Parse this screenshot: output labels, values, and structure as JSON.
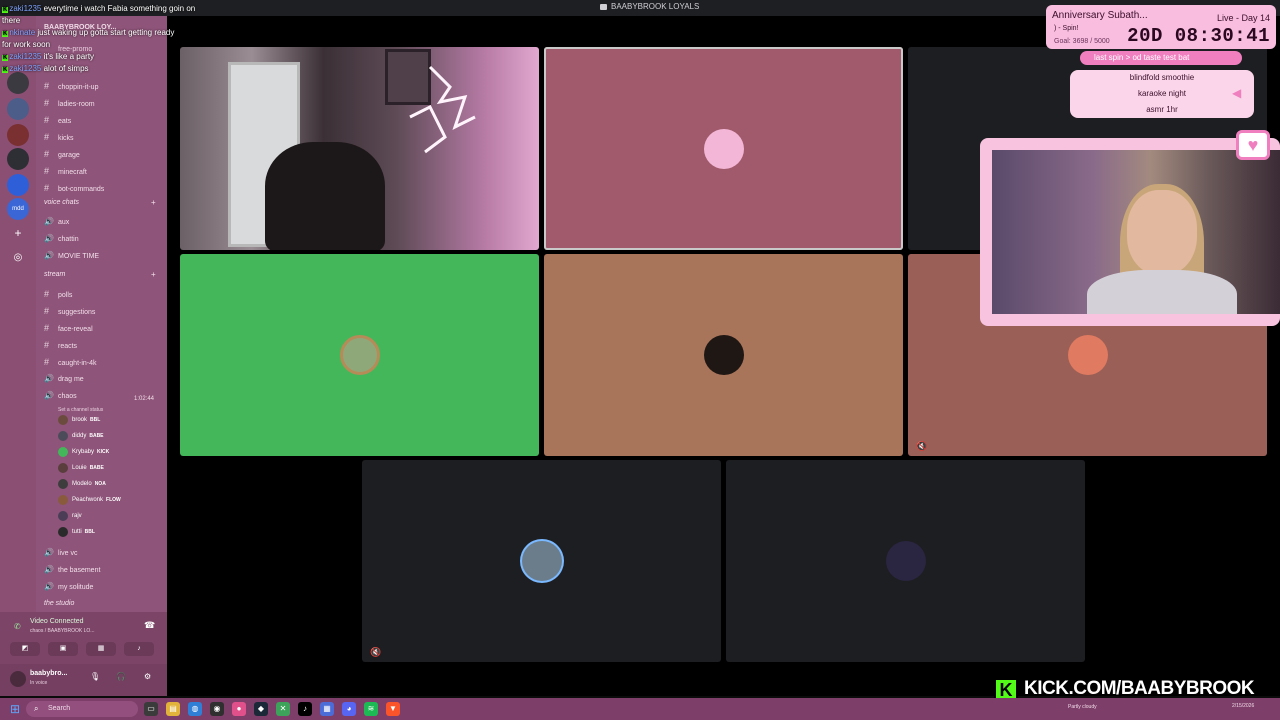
{
  "window": {
    "title": "BAABYBROOK LOYALS"
  },
  "server": {
    "name": "BAABYBROOK LOY...",
    "promo": "free-promo"
  },
  "chat": [
    {
      "user": "zaki1235",
      "text": "everytime i watch Fabia something goin on"
    },
    {
      "user": "",
      "text": "there"
    },
    {
      "user": "nkinate",
      "text": "just waking up gotta start getting ready"
    },
    {
      "user": "",
      "text": "for work soon"
    },
    {
      "user": "zaki1235",
      "text": "it's like a party"
    },
    {
      "user": "zaki1235",
      "text": "alot of simps"
    }
  ],
  "channels": {
    "text_top": [
      {
        "icon": "#",
        "label": "choppin-it-up"
      },
      {
        "icon": "#",
        "label": "ladies-room"
      },
      {
        "icon": "#",
        "label": "eats"
      },
      {
        "icon": "#",
        "label": "kicks"
      },
      {
        "icon": "#",
        "label": "garage"
      },
      {
        "icon": "#",
        "label": "minecraft"
      },
      {
        "icon": "#",
        "label": "bot-commands"
      }
    ],
    "voice_category": "voice chats",
    "voice_top": [
      {
        "icon": "🔊",
        "label": "aux"
      },
      {
        "icon": "🔊",
        "label": "chattin"
      },
      {
        "icon": "🔊",
        "label": "MOVIE TIME"
      }
    ],
    "stream_category": "stream",
    "stream_channels": [
      {
        "icon": "#",
        "label": "polls"
      },
      {
        "icon": "#",
        "label": "suggestions"
      },
      {
        "icon": "#",
        "label": "face-reveal"
      },
      {
        "icon": "#",
        "label": "reacts"
      },
      {
        "icon": "#",
        "label": "caught-in-4k"
      },
      {
        "icon": "🔊",
        "label": "drag me"
      }
    ],
    "active_voice": {
      "label": "chaos",
      "time": "1:02:44",
      "status": "Set a channel status"
    },
    "members": [
      {
        "name": "brook",
        "badge": "BBL"
      },
      {
        "name": "diddy",
        "badge": "BABE"
      },
      {
        "name": "Krybaby",
        "badge": "KICK"
      },
      {
        "name": "Louie",
        "badge": "BABE"
      },
      {
        "name": "Modelo",
        "badge": "NOA"
      },
      {
        "name": "Peachwonk",
        "badge": "FLOW"
      },
      {
        "name": "rajv",
        "badge": ""
      },
      {
        "name": "tutti",
        "badge": "BBL"
      }
    ],
    "voice_bottom": [
      {
        "icon": "🔊",
        "label": "live vc"
      },
      {
        "icon": "🔊",
        "label": "the basement"
      },
      {
        "icon": "🔊",
        "label": "my solitude"
      }
    ],
    "more_category": "the studio"
  },
  "voice_panel": {
    "status": "Video Connected",
    "sub": "chaos / BAABYBROOK LO..."
  },
  "user_panel": {
    "name": "baabybro...",
    "status": "In voice"
  },
  "widgets": {
    "subathon": {
      "title": "Anniversary Subath...",
      "live": "Live - Day 14",
      "spin": ") - Spin!",
      "goal": "Goal: 3698 / 5000",
      "timer": "20D 08:30:41"
    },
    "wheel": {
      "header": "last spin  >  od taste test bat",
      "items": [
        "blindfold smoothie",
        "karaoke night",
        "asmr 1hr"
      ]
    },
    "kick_url": "KICK.COM/BAABYBROOK"
  },
  "taskbar": {
    "search": "Search",
    "weather": "Partly cloudy",
    "date": "2/15/2026"
  },
  "colors": {
    "sidebar": "#8e5479",
    "accent_pink": "#f07fbf",
    "kick_green": "#53fc18",
    "discord_green": "#43b75a"
  }
}
